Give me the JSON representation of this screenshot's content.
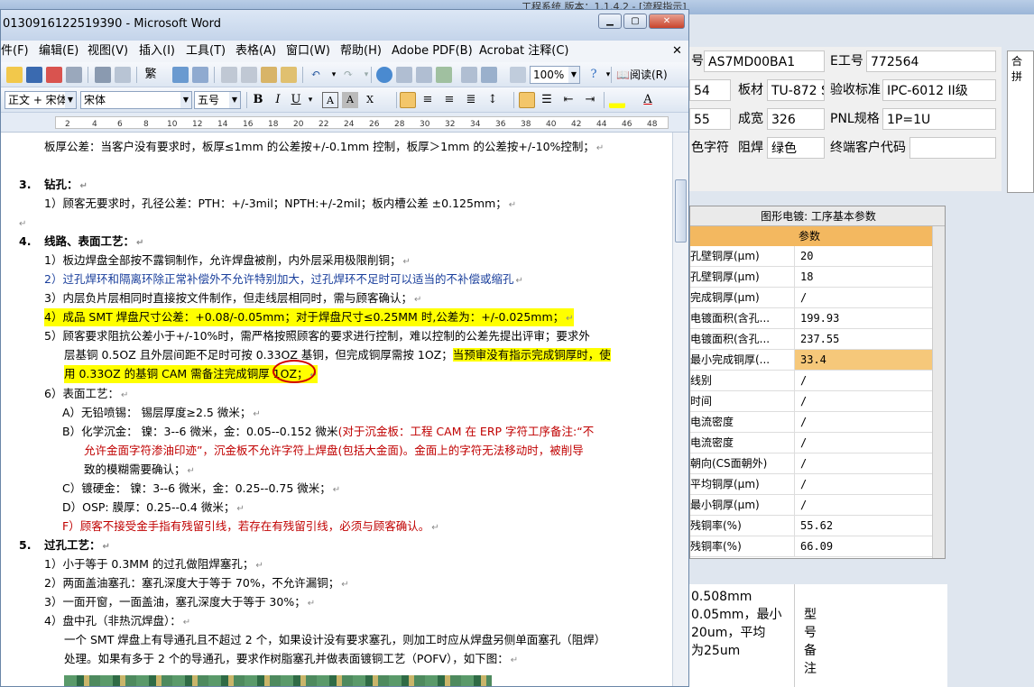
{
  "bg_app": {
    "title": "工程系统  版本：1.1.4.2 - [流程指示]",
    "fields": [
      {
        "label": "号",
        "value": "AS7MD00BA1"
      },
      {
        "label": "E工号",
        "value": "772564"
      },
      {
        "label": "合拼",
        "value": ""
      },
      {
        "label": "",
        "value": "54"
      },
      {
        "label": "板材",
        "value": "TU-872 S"
      },
      {
        "label": "验收标准",
        "value": "IPC-6012 II级"
      },
      {
        "label": "",
        "value": "55"
      },
      {
        "label": "成宽",
        "value": "326"
      },
      {
        "label": "PNL规格",
        "value": "1P=1U"
      },
      {
        "label": "色字符",
        "value": ""
      },
      {
        "label": "阻焊",
        "value": "绿色"
      },
      {
        "label": "终端客户代码",
        "value": ""
      }
    ],
    "grid": {
      "header": "图形电镀: 工序基本参数",
      "col2_header": "参数",
      "rows": [
        {
          "name": "孔壁铜厚(μm)",
          "value": "20"
        },
        {
          "name": "孔壁铜厚(μm)",
          "value": "18"
        },
        {
          "name": "完成铜厚(μm)",
          "value": "/"
        },
        {
          "name": "电镀面积(含孔...",
          "value": "199.93"
        },
        {
          "name": "电镀面积(含孔...",
          "value": "237.55"
        },
        {
          "name": "最小完成铜厚(...",
          "value": "33.4"
        },
        {
          "name": "线别",
          "value": "/"
        },
        {
          "name": "时间",
          "value": "/"
        },
        {
          "name": "电流密度",
          "value": "/"
        },
        {
          "name": "电流密度",
          "value": "/"
        },
        {
          "name": "朝向(CS面朝外)",
          "value": "/"
        },
        {
          "name": "平均铜厚(μm)",
          "value": "/"
        },
        {
          "name": "最小铜厚(μm)",
          "value": "/"
        },
        {
          "name": "残铜率(%)",
          "value": "55.62"
        },
        {
          "name": "残铜率(%)",
          "value": "66.09"
        }
      ]
    },
    "bottom_text": [
      "0.508mm",
      "0.05mm，最小",
      "20um，平均",
      "为25um"
    ],
    "remark_label": [
      "型",
      "号",
      "备",
      "注"
    ]
  },
  "word": {
    "title": "0130916122519390 - Microsoft Word",
    "menus": [
      "件(F)",
      "编辑(E)",
      "视图(V)",
      "插入(I)",
      "工具(T)",
      "表格(A)",
      "窗口(W)",
      "帮助(H)",
      "Adobe PDF(B)",
      "Acrobat 注释(C)"
    ],
    "zoom": "100%",
    "read_mode": "阅读(R)",
    "style": "正文 + 宋体",
    "font": "宋体",
    "size": "五号",
    "ruler_numbers": [
      "2",
      "4",
      "6",
      "8",
      "10",
      "12",
      "14",
      "16",
      "18",
      "20",
      "22",
      "24",
      "26",
      "28",
      "30",
      "32",
      "34",
      "36",
      "38",
      "40",
      "42",
      "44",
      "46",
      "48"
    ],
    "lines": [
      "板厚公差：当客户没有要求时，板厚≤1mm 的公差按+/-0.1mm 控制，板厚＞1mm 的公差按+/-10%控制；",
      "3.",
      "钻孔：",
      "1）顾客无要求时，孔径公差：PTH：+/-3mil；NPTH:+/-2mil；板内槽公差 ±0.125mm；",
      "4.",
      "线路、表面工艺：",
      "1）板边焊盘全部按不露铜制作，允许焊盘被削，内外层采用极限削铜；",
      "2）过孔焊环和隔离环除正常补偿外不允许特别加大，过孔焊环不足时可以适当的不补偿或缩孔",
      "3）内层负片层相同时直接按文件制作，但走线层相同时，需与顾客确认；",
      "4）成品 SMT 焊盘尺寸公差：+0.08/-0.05mm；对于焊盘尺寸≤0.25MM 时,公差为：+/-0.025mm；",
      "5）顾客要求阻抗公差小于+/-10%时，需严格按照顾客的要求进行控制，难以控制的公差先提出评审；要求外",
      "层基铜 0.5OZ 且外层间距不足时可按 0.33OZ 基铜，但完成铜厚需按 1OZ；",
      "当预审没有指示完成铜厚时，使",
      "用 0.33OZ 的基铜 CAM 需备注完成铜厚 1OZ；",
      "6）表面工艺：",
      "A）无铅喷锡：  锡层厚度≥2.5 微米；",
      "B）化学沉金：  镍：3--6 微米，金：0.05--0.152 微米",
      "(对于沉金板：工程 CAM 在 ERP 字符工序备注:“不",
      "允许金面字符渗油印迹”，沉金板不允许字符上焊盘(包括大金面)。金面上的字符无法移动时，被削导",
      "致的模糊需要确认；",
      "C）镀硬金：    镍：3--6 微米，金：0.25--0.75 微米；",
      "D）OSP:       膜厚：0.25--0.4 微米；",
      "F）顾客不接受金手指有残留引线，若存在有残留引线，必须与顾客确认。",
      "5.",
      "过孔工艺：",
      "1）小于等于 0.3MM 的过孔做阻焊塞孔；",
      "2）两面盖油塞孔：塞孔深度大于等于 70%，不允许漏铜；",
      "3）一面开窗，一面盖油，塞孔深度大于等于 30%；",
      "4）盘中孔（非热沉焊盘）：",
      "一个 SMT 焊盘上有导通孔且不超过 2 个，如果设计没有要求塞孔，则加工时应从焊盘另侧单面塞孔（阻焊）",
      "处理。如果有多于 2 个的导通孔，要求作树脂塞孔并做表面镀铜工艺（POFV），如下图："
    ]
  }
}
